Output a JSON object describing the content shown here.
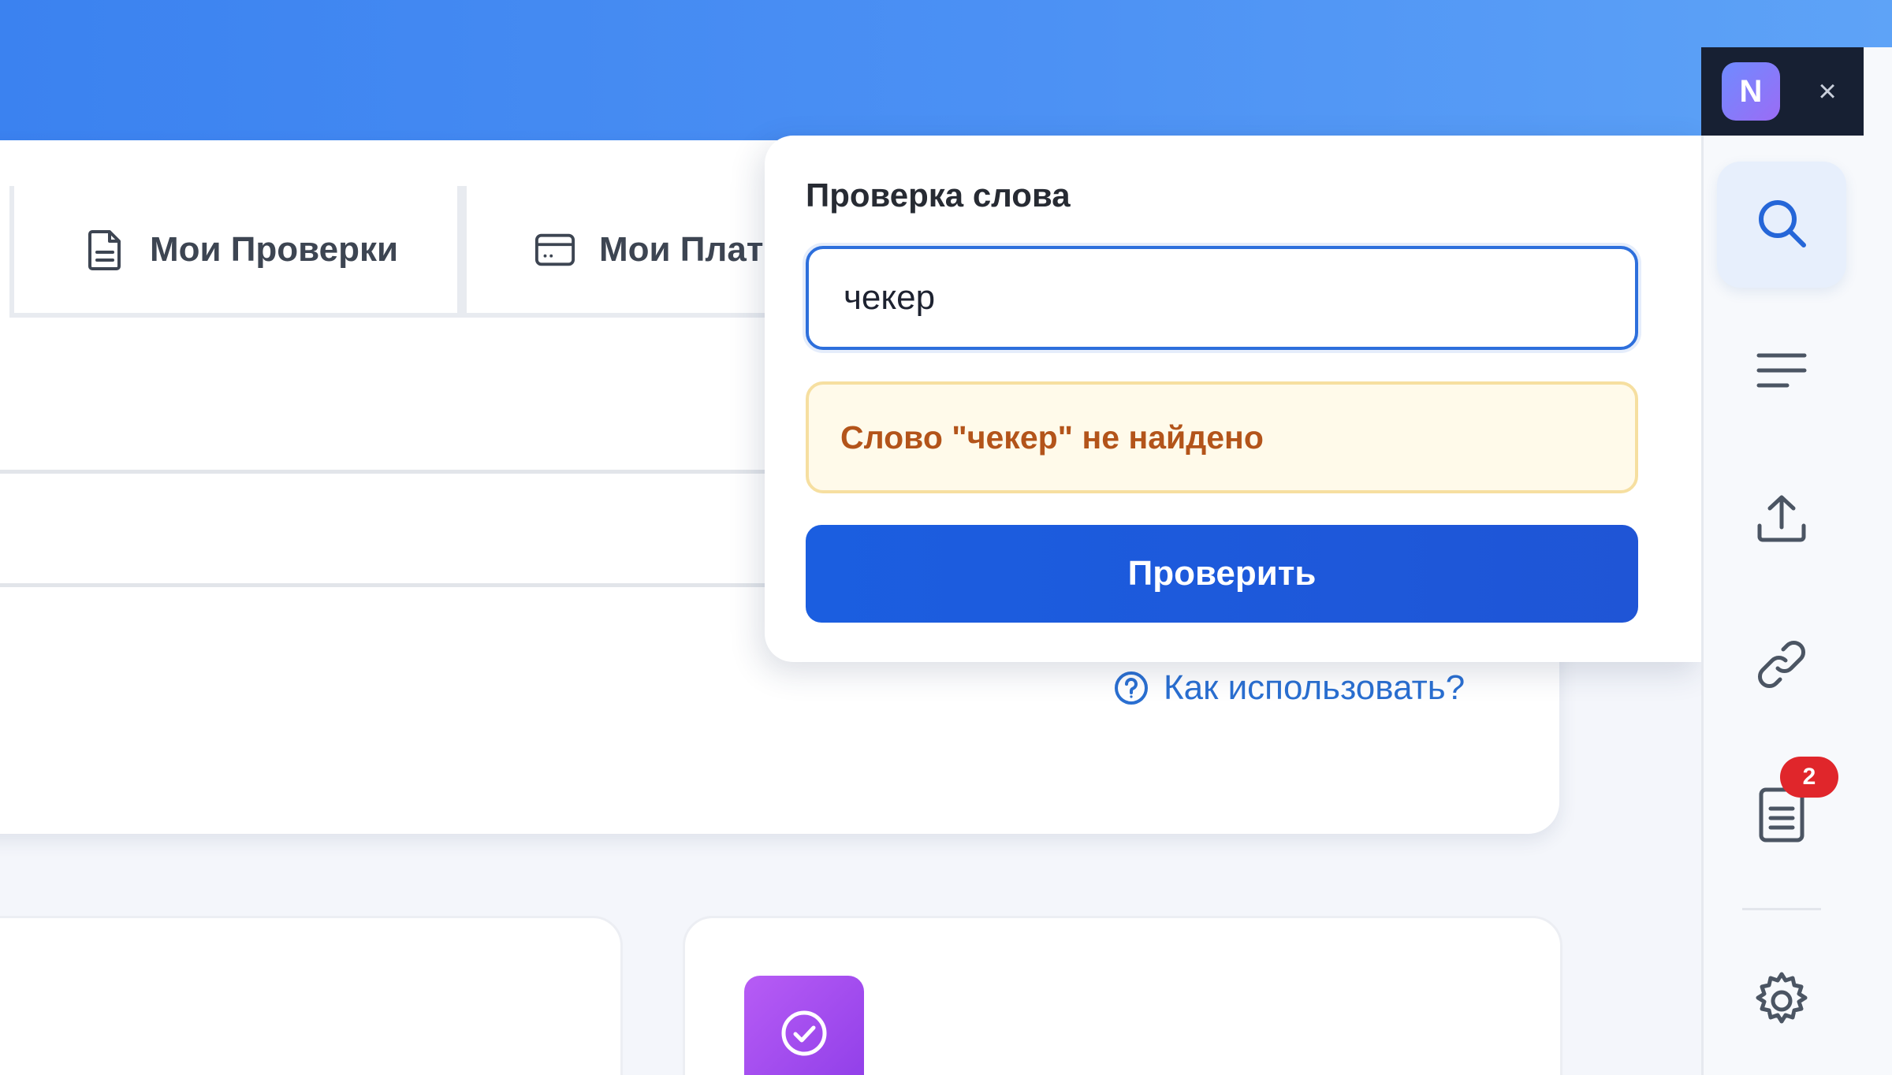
{
  "tabs": {
    "checks_label": "Мои Проверки",
    "payments_label": "Мои Плат"
  },
  "help": {
    "label": "Как использовать?"
  },
  "popup": {
    "title": "Проверка слова",
    "input_value": "чекер",
    "alert_text": "Слово \"чекер\" не найдено",
    "button_label": "Проверить"
  },
  "sidebar": {
    "avatar_letter": "N",
    "close_glyph": "×",
    "items": [
      {
        "icon": "search-icon",
        "active": true
      },
      {
        "icon": "menu-lines-icon",
        "active": false
      },
      {
        "icon": "upload-icon",
        "active": false
      },
      {
        "icon": "link-icon",
        "active": false
      },
      {
        "icon": "document-icon",
        "active": false,
        "badge": "2"
      },
      {
        "icon": "gear-icon",
        "active": false
      }
    ]
  },
  "colors": {
    "header_blue": "#3b82f0",
    "primary_button": "#1b5ee0",
    "alert_bg": "#fffaea",
    "alert_text": "#b3541a",
    "badge_red": "#e0262b",
    "avatar_purple": "#9b6cf5"
  }
}
